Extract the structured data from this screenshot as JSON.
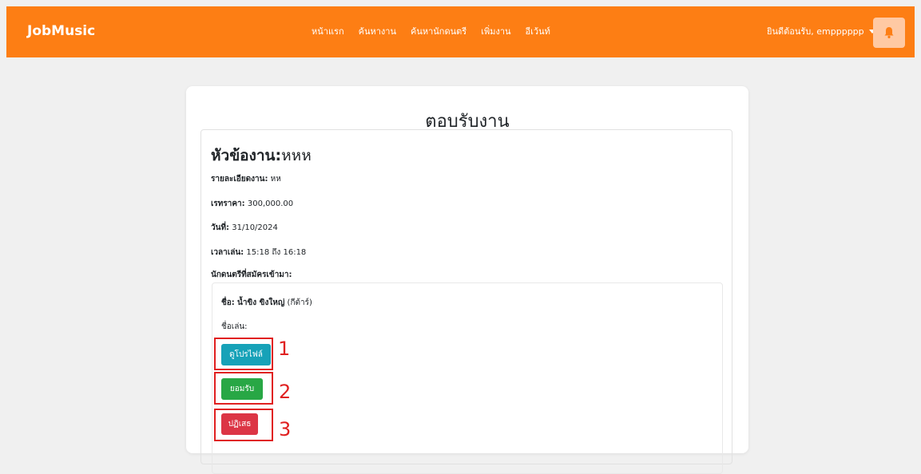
{
  "navbar": {
    "brand": "JobMusic",
    "links": [
      "หน้าแรก",
      "ค้นหางาน",
      "ค้นหานักดนตรี",
      "เพิ่มงาน",
      "อีเว้นท์"
    ],
    "user_greeting": "ยินดีต้อนรับ, empppppp",
    "bell_icon": "bell-icon",
    "colors": {
      "background": "#fd7e14",
      "bell_button": "#ffc9a3",
      "bell_icon": "#fd7e14"
    }
  },
  "page": {
    "title": "ตอบรับงาน"
  },
  "job": {
    "title_label": "หัวข้องาน:",
    "title_value": "หหห",
    "detail_label": "รายละเอียดงาน:",
    "detail_value": "หห",
    "rate_label": "เรทราคา:",
    "rate_value": "300,000.00",
    "date_label": "วันที่:",
    "date_value": "31/10/2024",
    "time_label": "เวลาเล่น:",
    "time_value": "15:18 ถึง 16:18",
    "applicants_label": "นักดนตรีที่สมัครเข้ามา:"
  },
  "applicant": {
    "name_label": "ชื่อ:",
    "name_value": "น้ำขิง ขิงใหญ่",
    "instrument": "(กีต้าร์)",
    "nickname_label": "ชื่อเล่น:",
    "nickname_value": ""
  },
  "buttons": {
    "view_profile": "ดูโปรไฟล์",
    "accept": "ยอมรับ",
    "reject": "ปฏิเสธ",
    "colors": {
      "view_profile": "#17a2b8",
      "accept": "#28a745",
      "reject": "#dc3545"
    }
  },
  "annotations": {
    "color": "#e02020",
    "labels": [
      "1",
      "2",
      "3"
    ]
  }
}
